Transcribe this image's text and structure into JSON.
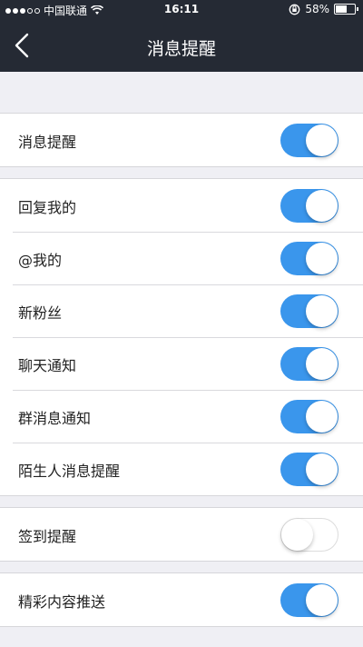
{
  "status_bar": {
    "carrier": "中国联通",
    "time": "16:11",
    "battery": "58%",
    "battery_level": 0.58
  },
  "nav": {
    "title": "消息提醒"
  },
  "groups": [
    [
      {
        "label": "消息提醒",
        "on": true
      }
    ],
    [
      {
        "label": "回复我的",
        "on": true
      },
      {
        "label": "@我的",
        "on": true
      },
      {
        "label": "新粉丝",
        "on": true
      },
      {
        "label": "聊天通知",
        "on": true
      },
      {
        "label": "群消息通知",
        "on": true
      },
      {
        "label": "陌生人消息提醒",
        "on": true
      }
    ],
    [
      {
        "label": "签到提醒",
        "on": false
      }
    ],
    [
      {
        "label": "精彩内容推送",
        "on": true
      }
    ]
  ]
}
